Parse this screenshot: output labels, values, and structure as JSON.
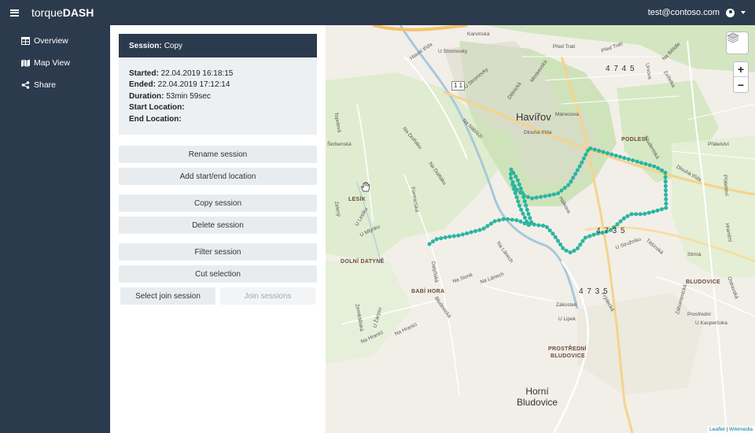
{
  "navbar": {
    "brand_light": "torque",
    "brand_bold": "DASH",
    "user_email": "test@contoso.com"
  },
  "sidebar": {
    "items": [
      {
        "label": "Overview",
        "icon": "table-icon"
      },
      {
        "label": "Map View",
        "icon": "map-icon"
      },
      {
        "label": "Share",
        "icon": "share-icon"
      }
    ]
  },
  "session": {
    "header_label": "Session:",
    "header_value": "Copy",
    "started_label": "Started:",
    "started_value": "22.04.2019 16:18:15",
    "ended_label": "Ended:",
    "ended_value": "22.04.2019 17:12:14",
    "duration_label": "Duration:",
    "duration_value": "53min 59sec",
    "start_location_label": "Start Location:",
    "start_location_value": "",
    "end_location_label": "End Location:",
    "end_location_value": ""
  },
  "buttons": {
    "rename": "Rename session",
    "add_location": "Add start/end location",
    "copy": "Copy session",
    "delete": "Delete session",
    "filter": "Filter session",
    "cut": "Cut selection",
    "select_join": "Select join session",
    "join": "Join sessions"
  },
  "map": {
    "towns": {
      "havirov": "Havířov",
      "horni": "Horní",
      "bludovice": "Bludovice"
    },
    "districts": {
      "podlesi": "PODLESÍ",
      "lesik": "LESÍK",
      "dolni_datyne": "DOLNÍ DATYNĚ",
      "babi_hora": "BABÍ HORA",
      "bludovice": "BLUDOVICE",
      "prostredni_1": "PROSTŘEDNÍ",
      "prostredni_2": "BLUDOVICE"
    },
    "road_numbers": {
      "r1": "4 7 4 5",
      "r2": "4 7 3 5",
      "r3": "4 7 3 5"
    },
    "shield": "1 1",
    "streets": {
      "karvinska": "Karvinská",
      "hlavni_trida": "Hlavní třída",
      "u_stromovky": "U Stromovky",
      "u_stromovky2": "U Stromovky",
      "delnicka": "Dělnická",
      "moskevska": "Moskevská",
      "prednitrati": "Před Tratí",
      "prednitrati2": "Před Tratí",
      "na_nabrezi": "Na Nábřeží",
      "dlouha_trida": "Dlouhá třída",
      "dlouha_trida2": "Dlouhá třída",
      "manesova": "Mánesova",
      "na_belidle": "Na Bělidle",
      "zvirotka": "Zvířetka",
      "urxova": "Urxova",
      "studentska": "Studentská",
      "pratelstvi": "Přátelství",
      "topolova": "Topolová",
      "skrbenska": "Škrbenská",
      "na_dolnaku": "Na Dolňáku",
      "na_dolnaku2": "Na Dolňáku",
      "fojtska": "Formanská",
      "u_lesiku": "U Lesíku",
      "zeleny": "Zelený",
      "u_mlynku": "U Mlýnku",
      "halkova": "Hálkova",
      "u_struzniku": "U Stružníku",
      "teslanska": "Těšínská",
      "strma": "Strmá",
      "hranicni": "Hraniční",
      "pratelstvi2": "Přátelství",
      "na_lanech": "Na Lánech",
      "na_lanech2": "Na Lánech",
      "na_sione": "Na Sioně",
      "datynska": "Datyňská",
      "u_zaryjsu": "U Žárysu",
      "zemedelska": "Zemědělská",
      "na_hranici": "Na Hranici",
      "na_hranici2": "Na Hranici",
      "zakostelí": "Zákostelí",
      "u_lipek": "U Lipek",
      "frydecka": "Frýdecká",
      "u_kasparcka": "U Kasperčoka",
      "prostredni": "Prostřední",
      "ostravska": "Ostravská",
      "zahumenicka": "Záhumenická",
      "bludovicka": "Bludovická"
    },
    "attribution_1": "Leaflet",
    "attribution_sep": " | ",
    "attribution_2": "Wikimedia",
    "track_color": "#2bb5a0"
  }
}
